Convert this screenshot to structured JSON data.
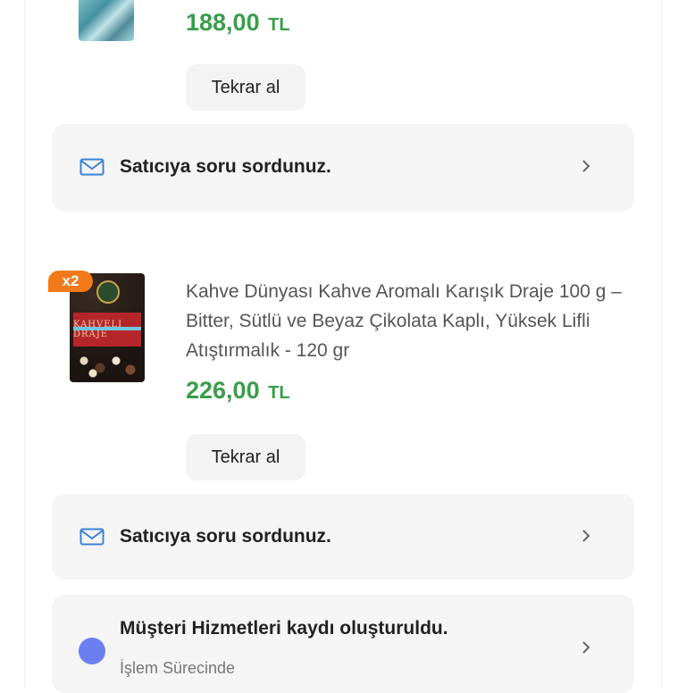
{
  "orders": [
    {
      "price_amount": "188,00",
      "price_currency": "TL",
      "rebuy_label": "Tekrar al",
      "seller_question": "Satıcıya soru sordunuz."
    },
    {
      "quantity_badge": "x2",
      "product_name": "Kahve Dünyası Kahve Aromalı Karışık Draje 100 g – Bitter, Sütlü ve Beyaz Çikolata Kaplı, Yüksek Lifli Atıştırmalık - 120 gr",
      "price_amount": "226,00",
      "price_currency": "TL",
      "rebuy_label": "Tekrar al",
      "seller_question": "Satıcıya soru sordunuz.",
      "product_image_text": "KAHVELI DRAJE"
    }
  ],
  "customer_service": {
    "title": "Müşteri Hizmetleri kaydı oluşturuldu.",
    "status": "İşlem Sürecinde",
    "status_color": "#6b7ff0"
  },
  "colors": {
    "price": "#3a9d4a",
    "badge": "#f27a1a",
    "mail_icon": "#3b82d6"
  }
}
